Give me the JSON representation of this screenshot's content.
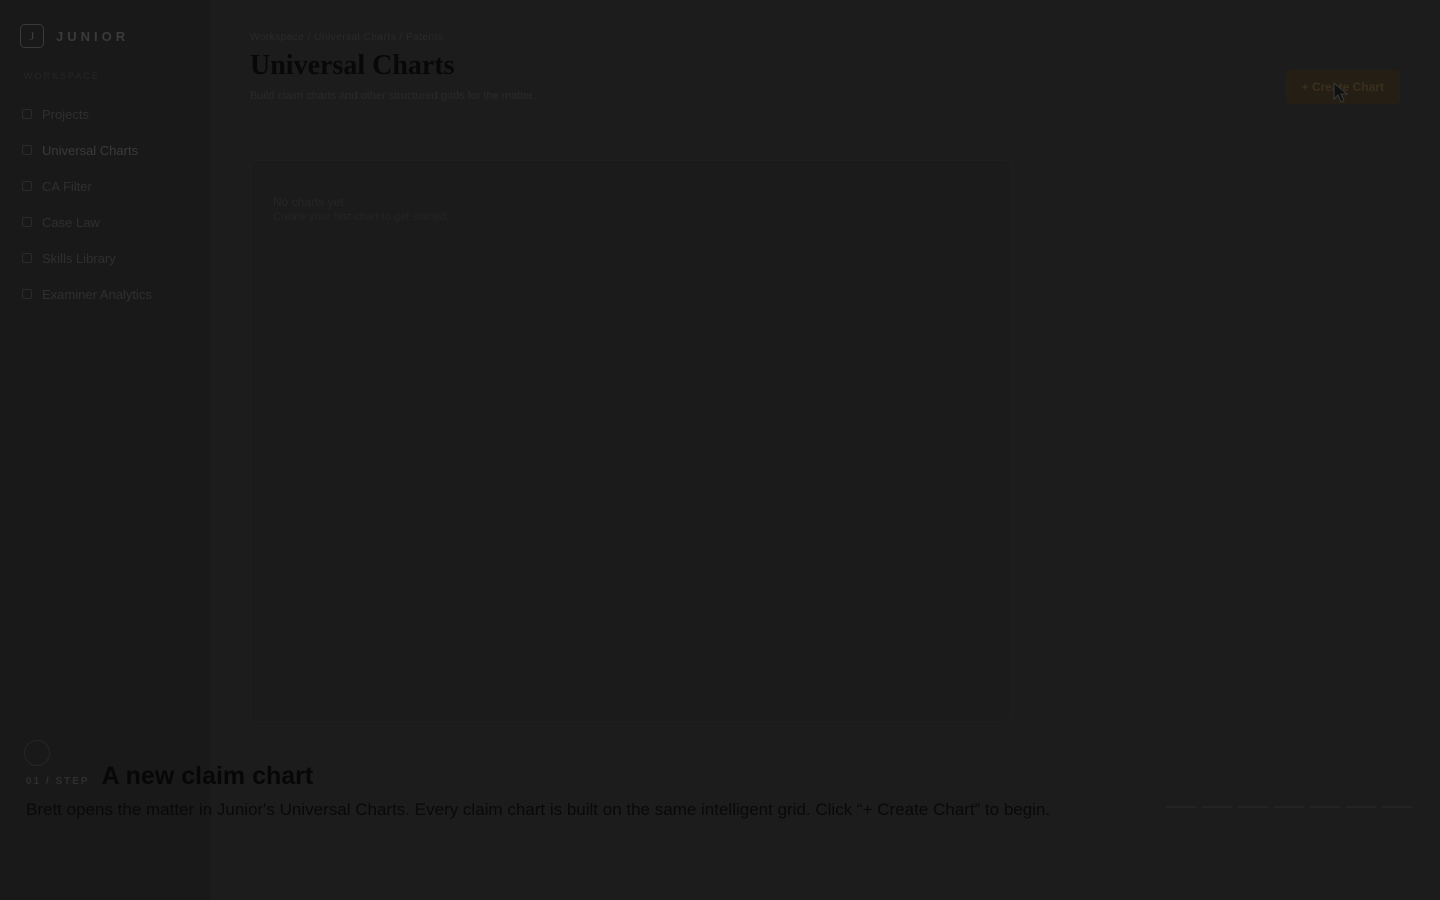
{
  "brand": {
    "logo_letter": "J",
    "name": "JUNIOR"
  },
  "sidebar": {
    "section_label": "WORKSPACE",
    "items": [
      {
        "label": "Projects",
        "icon": "grid-icon"
      },
      {
        "label": "Universal Charts",
        "icon": "chart-icon",
        "active": true
      },
      {
        "label": "CA Filter",
        "icon": "filter-icon"
      },
      {
        "label": "Case Law",
        "icon": "scale-icon"
      },
      {
        "label": "Skills Library",
        "icon": "book-icon"
      },
      {
        "label": "Examiner Analytics",
        "icon": "analytics-icon"
      }
    ]
  },
  "header": {
    "breadcrumb": "Workspace / Universal Charts / Patents",
    "title": "Universal Charts",
    "subtitle": "Build claim charts and other structured grids for the matter.",
    "create_button": "+ Create Chart"
  },
  "main": {
    "empty_title": "No charts yet",
    "empty_desc": "Create your first chart to get started."
  },
  "tutorial": {
    "step_label": "01 / STEP",
    "title": "A new claim chart",
    "text": "Brett opens the matter in Junior's Universal Charts. Every claim chart is built on the same intelligent grid. Click “+ Create Chart” to begin."
  },
  "colors": {
    "background": "#1c1c1c",
    "accent": "#241e14"
  }
}
